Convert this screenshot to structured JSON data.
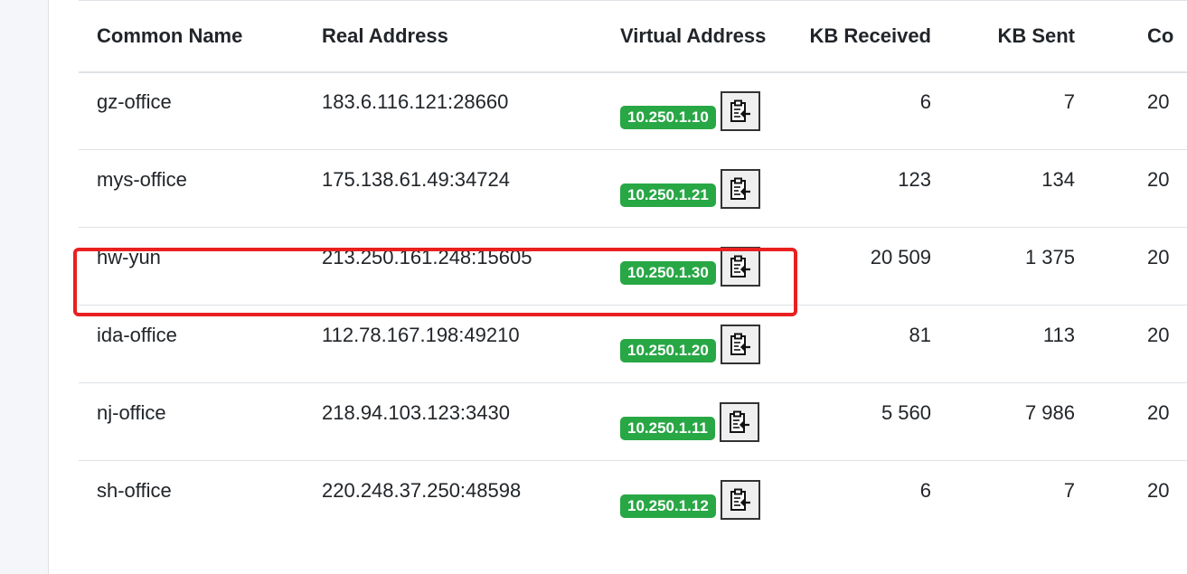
{
  "table": {
    "headers": {
      "common_name": "Common Name",
      "real_address": "Real Address",
      "virtual_address": "Virtual Address",
      "kb_received": "KB Received",
      "kb_sent": "KB Sent",
      "connected_since": "Co"
    },
    "rows": [
      {
        "common_name": "gz-office",
        "real_address": "183.6.116.121:28660",
        "virtual_address": "10.250.1.10",
        "kb_received": "6",
        "kb_sent": "7",
        "connected_since": "20"
      },
      {
        "common_name": "mys-office",
        "real_address": "175.138.61.49:34724",
        "virtual_address": "10.250.1.21",
        "kb_received": "123",
        "kb_sent": "134",
        "connected_since": "20"
      },
      {
        "common_name": "hw-yun",
        "real_address": "213.250.161.248:15605",
        "virtual_address": "10.250.1.30",
        "kb_received": "20 509",
        "kb_sent": "1 375",
        "connected_since": "20"
      },
      {
        "common_name": "ida-office",
        "real_address": "112.78.167.198:49210",
        "virtual_address": "10.250.1.20",
        "kb_received": "81",
        "kb_sent": "113",
        "connected_since": "20"
      },
      {
        "common_name": "nj-office",
        "real_address": "218.94.103.123:3430",
        "virtual_address": "10.250.1.11",
        "kb_received": "5 560",
        "kb_sent": "7 986",
        "connected_since": "20"
      },
      {
        "common_name": "sh-office",
        "real_address": "220.248.37.250:48598",
        "virtual_address": "10.250.1.12",
        "kb_received": "6",
        "kb_sent": "7",
        "connected_since": "20"
      }
    ]
  },
  "highlighted_row": "hw-yun",
  "colors": {
    "badge": "#28a745",
    "highlight": "#e8201f",
    "border": "#dee2e6"
  },
  "icons": {
    "copy_button": "clipboard-copy-icon"
  }
}
